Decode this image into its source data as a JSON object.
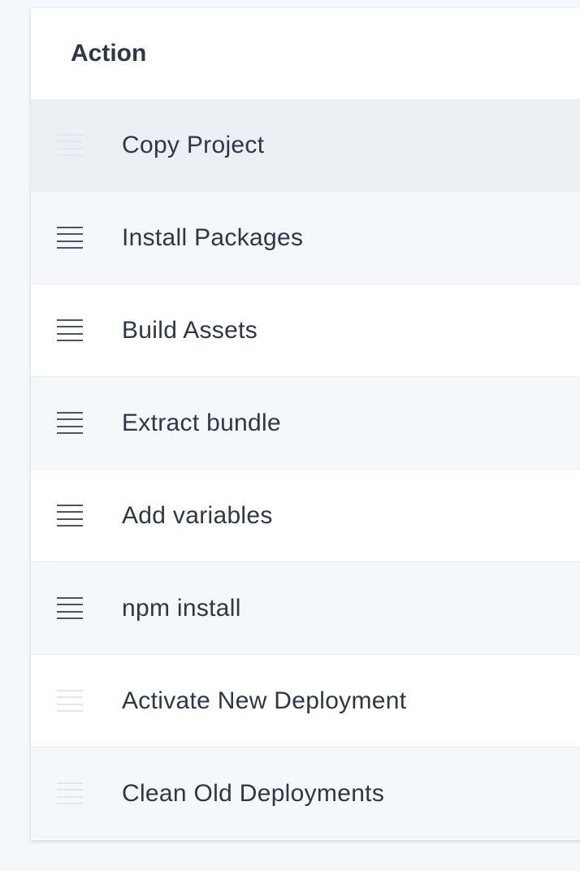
{
  "table": {
    "header": "Action",
    "rows": [
      {
        "label": "Copy Project",
        "draggable": false,
        "state": "hover"
      },
      {
        "label": "Install Packages",
        "draggable": true,
        "state": "alt"
      },
      {
        "label": "Build Assets",
        "draggable": true,
        "state": "normal"
      },
      {
        "label": "Extract bundle",
        "draggable": true,
        "state": "alt"
      },
      {
        "label": "Add variables",
        "draggable": true,
        "state": "normal"
      },
      {
        "label": "npm install",
        "draggable": true,
        "state": "alt"
      },
      {
        "label": "Activate New Deployment",
        "draggable": false,
        "state": "normal"
      },
      {
        "label": "Clean Old Deployments",
        "draggable": false,
        "state": "alt"
      }
    ]
  },
  "colors": {
    "text": "#2d3748",
    "handle_active": "#4a5568",
    "handle_disabled": "#e2e7ef",
    "row_alt": "#f5f8fb",
    "row_hover": "#ecf0f5"
  }
}
